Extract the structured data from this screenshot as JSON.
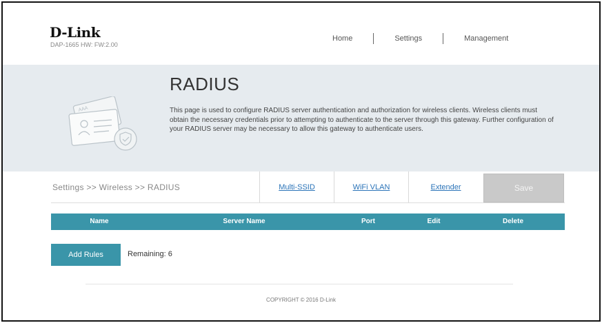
{
  "brand": {
    "logo": "D-Link",
    "model_info": "DAP-1665 HW: FW:2.00"
  },
  "nav": {
    "home": "Home",
    "settings": "Settings",
    "management": "Management"
  },
  "banner": {
    "title": "RADIUS",
    "description": "This page is used to configure RADIUS server authentication and authorization for wireless clients. Wireless clients must obtain the necessary credentials prior to attempting to authenticate to the server through this gateway. Further configuration of your RADIUS server may be necessary to allow this gateway to authenticate users."
  },
  "breadcrumb": "Settings >> Wireless >> RADIUS",
  "tabs": {
    "multi_ssid": "Multi-SSID",
    "wifi_vlan": "WiFi VLAN",
    "extender": "Extender"
  },
  "save_label": "Save",
  "table": {
    "columns": {
      "name": "Name",
      "server_name": "Server Name",
      "port": "Port",
      "edit": "Edit",
      "delete": "Delete"
    }
  },
  "add_rules_label": "Add Rules",
  "remaining": "Remaining: 6",
  "copyright": "COPYRIGHT © 2016 D-Link",
  "colors": {
    "accent": "#3a95a9",
    "link": "#2a73b8",
    "banner_bg": "#e6ebef",
    "save_disabled": "#c9c9c9"
  }
}
